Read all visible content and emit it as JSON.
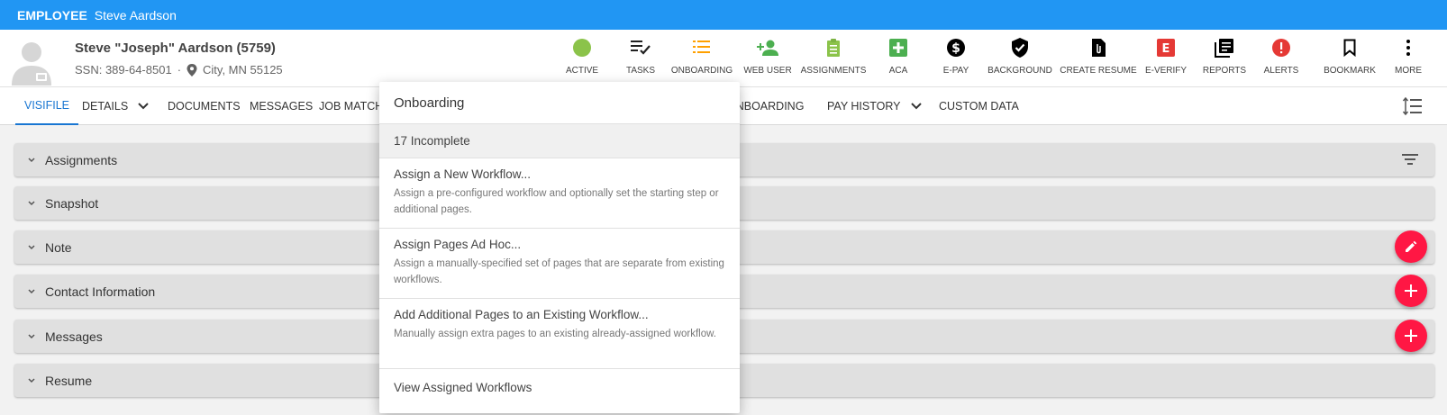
{
  "topbar": {
    "kind": "EMPLOYEE",
    "name": "Steve Aardson"
  },
  "employee": {
    "display_name": "Steve \"Joseph\" Aardson (5759)",
    "ssn": "SSN: 389-64-8501",
    "separator": "·",
    "location": "City, MN 55125"
  },
  "actions": [
    {
      "label": "ACTIVE",
      "icon": "active-dot-icon",
      "color": "#8bc34a"
    },
    {
      "label": "TASKS",
      "icon": "tasks-icon",
      "color": "#212121"
    },
    {
      "label": "ONBOARDING",
      "icon": "onboarding-list-icon",
      "color": "#ffa000"
    },
    {
      "label": "WEB USER",
      "icon": "add-person-icon",
      "color": "#4caf50"
    },
    {
      "label": "ASSIGNMENTS",
      "icon": "clipboard-icon",
      "color": "#8bc34a"
    },
    {
      "label": "ACA",
      "icon": "plus-square-icon",
      "color": "#4caf50"
    },
    {
      "label": "E-PAY",
      "icon": "dollar-icon",
      "color": "#000000"
    },
    {
      "label": "BACKGROUND",
      "icon": "shield-check-icon",
      "color": "#000000"
    },
    {
      "label": "CREATE RESUME",
      "icon": "attachment-doc-icon",
      "color": "#000000"
    },
    {
      "label": "E-VERIFY",
      "icon": "e-verify-icon",
      "color": "#e53935"
    },
    {
      "label": "REPORTS",
      "icon": "reports-icon",
      "color": "#000000"
    },
    {
      "label": "ALERTS",
      "icon": "alert-icon",
      "color": "#e53935"
    },
    {
      "label": "BOOKMARK",
      "icon": "bookmark-icon",
      "color": "#000000"
    },
    {
      "label": "MORE",
      "icon": "more-vertical-icon",
      "color": "#000000"
    }
  ],
  "tabs": [
    {
      "label": "VISIFILE",
      "active": true
    },
    {
      "label": "DETAILS"
    },
    {
      "label": "DOCUMENTS"
    },
    {
      "label": "MESSAGES"
    },
    {
      "label": "JOB MATCH"
    },
    {
      "label": "ONBOARDING"
    },
    {
      "label": "PAY HISTORY"
    },
    {
      "label": "CUSTOM DATA"
    }
  ],
  "panels": [
    "Assignments",
    "Snapshot",
    "Note",
    "Contact Information",
    "Messages",
    "Resume"
  ],
  "menu": {
    "title": "Onboarding",
    "subtitle": "17 Incomplete",
    "items": [
      {
        "title": "Assign a New Workflow...",
        "desc": "Assign a pre-configured workflow and optionally set the starting step or additional pages."
      },
      {
        "title": "Assign Pages Ad Hoc...",
        "desc": "Assign a manually-specified set of pages that are separate from existing workflows."
      },
      {
        "title": "Add Additional Pages to an Existing Workflow...",
        "desc": "Manually assign extra pages to an existing already-assigned workflow."
      }
    ],
    "last": "View Assigned Workflows"
  },
  "colors": {
    "topbar": "#2196f3",
    "accent": "#1976d2",
    "fab": "#ff1744"
  }
}
